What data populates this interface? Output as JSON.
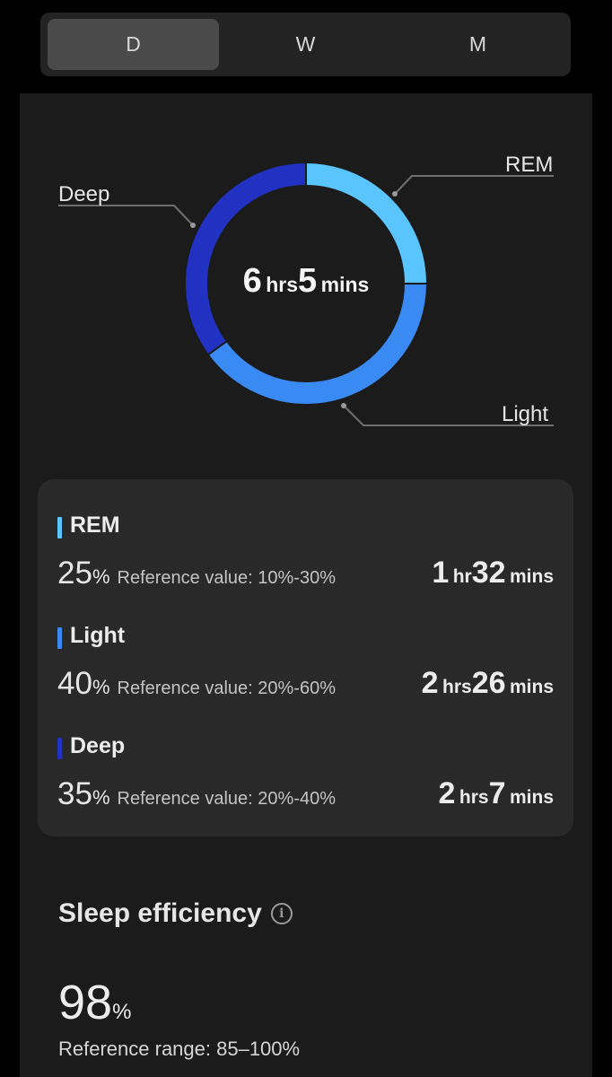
{
  "tabs": [
    {
      "label": "D",
      "active": true
    },
    {
      "label": "W",
      "active": false
    },
    {
      "label": "M",
      "active": false
    }
  ],
  "colors": {
    "rem": "#5ac5fd",
    "light": "#3a8af3",
    "deep": "#2131c1",
    "card_bg": "#1b1b1b",
    "panel_bg": "#292929"
  },
  "donut": {
    "labels": {
      "rem": "REM",
      "deep": "Deep",
      "light": "Light"
    },
    "total": {
      "hours": "6",
      "hours_unit": "hrs",
      "minutes": "5",
      "minutes_unit": "mins"
    }
  },
  "chart_data": {
    "type": "pie",
    "categories": [
      "REM",
      "Light",
      "Deep"
    ],
    "values": [
      25,
      40,
      35
    ],
    "colors": [
      "#5ac5fd",
      "#3a8af3",
      "#2131c1"
    ]
  },
  "stages": [
    {
      "key": "rem",
      "name": "REM",
      "percent": "25",
      "percent_unit": "%",
      "reference": "Reference value: 10%-30%",
      "hours": "1",
      "hours_unit": "hr",
      "minutes": "32",
      "minutes_unit": "mins"
    },
    {
      "key": "light",
      "name": "Light",
      "percent": "40",
      "percent_unit": "%",
      "reference": "Reference value: 20%-60%",
      "hours": "2",
      "hours_unit": "hrs",
      "minutes": "26",
      "minutes_unit": "mins"
    },
    {
      "key": "deep",
      "name": "Deep",
      "percent": "35",
      "percent_unit": "%",
      "reference": "Reference value: 20%-40%",
      "hours": "2",
      "hours_unit": "hrs",
      "minutes": "7",
      "minutes_unit": "mins"
    }
  ],
  "efficiency": {
    "title": "Sleep efficiency",
    "info_icon": "info-icon",
    "value": "98",
    "unit": "%",
    "reference": "Reference range: 85–100%"
  }
}
